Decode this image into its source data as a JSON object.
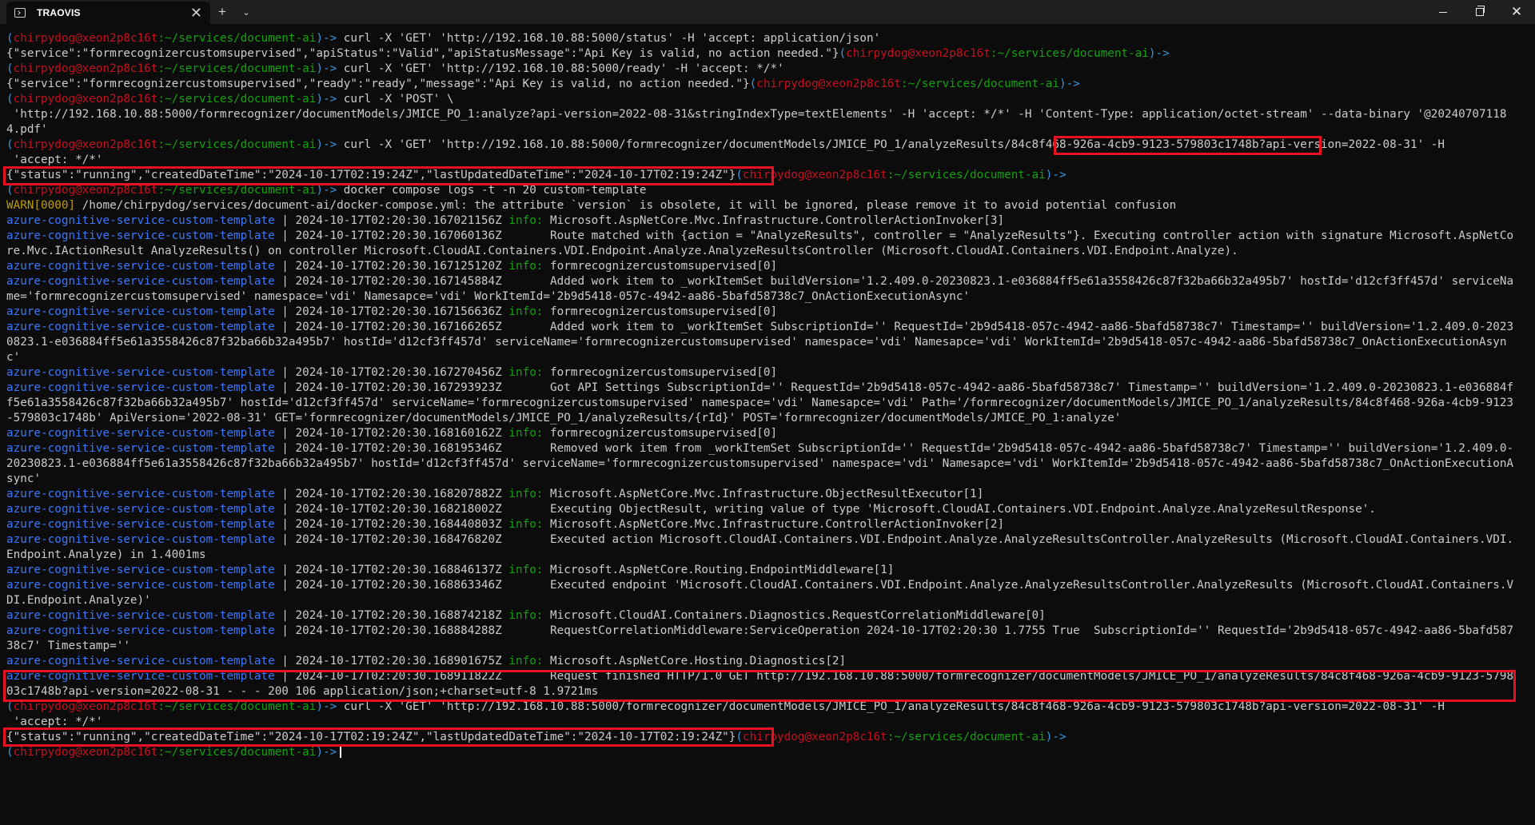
{
  "window": {
    "tab_title": "TRAOVIS",
    "tab_icon": "terminal-icon",
    "close_tab_glyph": "✕",
    "new_tab_glyph": "+",
    "dropdown_glyph": "⌄"
  },
  "prompt": {
    "user_host": "chirpydog@xeon2p8c16t",
    "path": ":~/services/document-ai",
    "open": "(",
    "close": ")->"
  },
  "commands": [
    " curl -X 'GET' 'http://192.168.10.88:5000/status' -H 'accept: application/json'",
    " curl -X 'GET' 'http://192.168.10.88:5000/ready' -H 'accept: */*'",
    " curl -X 'POST' \\",
    " curl -X 'GET' 'http://192.168.10.88:5000/formrecognizer/documentModels/JMICE_PO_1/analyzeResults/",
    " docker compose logs -t -n 20 custom-template",
    " curl -X 'GET' 'http://192.168.10.88:5000/formrecognizer/documentModels/JMICE_PO_1/analyzeResults/84c8f468-926a-4cb9-9123-579803c1748b?api-version=2022-08-31' -H"
  ],
  "outputs": {
    "status": "{\"service\":\"formrecognizercustomsupervised\",\"apiStatus\":\"Valid\",\"apiStatusMessage\":\"Api Key is valid, no action needed.\"}",
    "ready": "{\"service\":\"formrecognizercustomsupervised\",\"ready\":\"ready\",\"message\":\"Api Key is valid, no action needed.\"}",
    "post_cont": " 'http://192.168.10.88:5000/formrecognizer/documentModels/JMICE_PO_1:analyze?api-version=2022-08-31&stringIndexType=textElements' -H 'accept: */*' -H 'Content-Type: application/octet-stream' --data-binary '@202407071184.pdf'",
    "result_id": "84c8f468-926a-4cb9-9123-579803c1748b",
    "get_tail": "?api-version=2022-08-31' -H",
    "accept_line": " 'accept: */*'",
    "running": "{\"status\":\"running\",\"createdDateTime\":\"2024-10-17T02:19:24Z\",\"lastUpdatedDateTime\":\"2024-10-17T02:19:24Z\"}",
    "warn_tag": "WARN[0000]",
    "warn_text": " /home/chirpydog/services/document-ai/docker-compose.yml: the attribute `version` is obsolete, it will be ignored, please remove it to avoid potential confusion"
  },
  "log_service": "azure-cognitive-service-custom-template",
  "log_sep": " | ",
  "logs": [
    {
      "ts": "2024-10-17T02:20:30.167021156Z",
      "level": "info:",
      "msg": " Microsoft.AspNetCore.Mvc.Infrastructure.ControllerActionInvoker[3]"
    },
    {
      "ts": "2024-10-17T02:20:30.167060136Z",
      "level": "",
      "msg": "       Route matched with {action = \"AnalyzeResults\", controller = \"AnalyzeResults\"}. Executing controller action with signature Microsoft.AspNetCore.Mvc.IActionResult AnalyzeResults() on controller Microsoft.CloudAI.Containers.VDI.Endpoint.Analyze.AnalyzeResultsController (Microsoft.CloudAI.Containers.VDI.Endpoint.Analyze)."
    },
    {
      "ts": "2024-10-17T02:20:30.167125120Z",
      "level": "info:",
      "msg": " formrecognizercustomsupervised[0]"
    },
    {
      "ts": "2024-10-17T02:20:30.167145884Z",
      "level": "",
      "msg": "       Added work item to _workItemSet buildVersion='1.2.409.0-20230823.1-e036884ff5e61a3558426c87f32ba66b32a495b7' hostId='d12cf3ff457d' serviceName='formrecognizercustomsupervised' namespace='vdi' Namesapce='vdi' WorkItemId='2b9d5418-057c-4942-aa86-5bafd58738c7_OnActionExecutionAsync'"
    },
    {
      "ts": "2024-10-17T02:20:30.167156636Z",
      "level": "info:",
      "msg": " formrecognizercustomsupervised[0]"
    },
    {
      "ts": "2024-10-17T02:20:30.167166265Z",
      "level": "",
      "msg": "       Added work item to _workItemSet SubscriptionId='' RequestId='2b9d5418-057c-4942-aa86-5bafd58738c7' Timestamp='' buildVersion='1.2.409.0-20230823.1-e036884ff5e61a3558426c87f32ba66b32a495b7' hostId='d12cf3ff457d' serviceName='formrecognizercustomsupervised' namespace='vdi' Namesapce='vdi' WorkItemId='2b9d5418-057c-4942-aa86-5bafd58738c7_OnActionExecutionAsync'"
    },
    {
      "ts": "2024-10-17T02:20:30.167270456Z",
      "level": "info:",
      "msg": " formrecognizercustomsupervised[0]"
    },
    {
      "ts": "2024-10-17T02:20:30.167293923Z",
      "level": "",
      "msg": "       Got API Settings SubscriptionId='' RequestId='2b9d5418-057c-4942-aa86-5bafd58738c7' Timestamp='' buildVersion='1.2.409.0-20230823.1-e036884ff5e61a3558426c87f32ba66b32a495b7' hostId='d12cf3ff457d' serviceName='formrecognizercustomsupervised' namespace='vdi' Namesapce='vdi' Path='/formrecognizer/documentModels/JMICE_PO_1/analyzeResults/84c8f468-926a-4cb9-9123-579803c1748b' ApiVersion='2022-08-31' GET='formrecognizer/documentModels/JMICE_PO_1/analyzeResults/{rId}' POST='formrecognizer/documentModels/JMICE_PO_1:analyze'"
    },
    {
      "ts": "2024-10-17T02:20:30.168160162Z",
      "level": "info:",
      "msg": " formrecognizercustomsupervised[0]"
    },
    {
      "ts": "2024-10-17T02:20:30.168195346Z",
      "level": "",
      "msg": "       Removed work item from _workItemSet SubscriptionId='' RequestId='2b9d5418-057c-4942-aa86-5bafd58738c7' Timestamp='' buildVersion='1.2.409.0-20230823.1-e036884ff5e61a3558426c87f32ba66b32a495b7' hostId='d12cf3ff457d' serviceName='formrecognizercustomsupervised' namespace='vdi' Namesapce='vdi' WorkItemId='2b9d5418-057c-4942-aa86-5bafd58738c7_OnActionExecutionAsync'"
    },
    {
      "ts": "2024-10-17T02:20:30.168207882Z",
      "level": "info:",
      "msg": " Microsoft.AspNetCore.Mvc.Infrastructure.ObjectResultExecutor[1]"
    },
    {
      "ts": "2024-10-17T02:20:30.168218002Z",
      "level": "",
      "msg": "       Executing ObjectResult, writing value of type 'Microsoft.CloudAI.Containers.VDI.Endpoint.Analyze.AnalyzeResultResponse'."
    },
    {
      "ts": "2024-10-17T02:20:30.168440803Z",
      "level": "info:",
      "msg": " Microsoft.AspNetCore.Mvc.Infrastructure.ControllerActionInvoker[2]"
    },
    {
      "ts": "2024-10-17T02:20:30.168476820Z",
      "level": "",
      "msg": "       Executed action Microsoft.CloudAI.Containers.VDI.Endpoint.Analyze.AnalyzeResultsController.AnalyzeResults (Microsoft.CloudAI.Containers.VDI.Endpoint.Analyze) in 1.4001ms"
    },
    {
      "ts": "2024-10-17T02:20:30.168846137Z",
      "level": "info:",
      "msg": " Microsoft.AspNetCore.Routing.EndpointMiddleware[1]"
    },
    {
      "ts": "2024-10-17T02:20:30.168863346Z",
      "level": "",
      "msg": "       Executed endpoint 'Microsoft.CloudAI.Containers.VDI.Endpoint.Analyze.AnalyzeResultsController.AnalyzeResults (Microsoft.CloudAI.Containers.VDI.Endpoint.Analyze)'"
    },
    {
      "ts": "2024-10-17T02:20:30.168874218Z",
      "level": "info:",
      "msg": " Microsoft.CloudAI.Containers.Diagnostics.RequestCorrelationMiddleware[0]"
    },
    {
      "ts": "2024-10-17T02:20:30.168884288Z",
      "level": "",
      "msg": "       RequestCorrelationMiddleware:ServiceOperation 2024-10-17T02:20:30 1.7755 True  SubscriptionId='' RequestId='2b9d5418-057c-4942-aa86-5bafd58738c7' Timestamp=''"
    },
    {
      "ts": "2024-10-17T02:20:30.168901675Z",
      "level": "info:",
      "msg": " Microsoft.AspNetCore.Hosting.Diagnostics[2]"
    },
    {
      "ts": "2024-10-17T02:20:30.168911822Z",
      "level": "",
      "msg": "       Request finished HTTP/1.0 GET http://192.168.10.88:5000/formrecognizer/documentModels/JMICE_PO_1/analyzeResults/84c8f468-926a-4cb9-9123-579803c1748b?api-version=2022-08-31 - - - 200 106 application/json;+charset=utf-8 1.9721ms"
    }
  ],
  "colors": {
    "background": "#0c0c0c",
    "titlebar": "#1f1f1f",
    "user": "#c50f1f",
    "path": "#13a10e",
    "service": "#3b78ff",
    "info": "#13a10e",
    "warn": "#c19c00",
    "highlight": "#e81123"
  }
}
